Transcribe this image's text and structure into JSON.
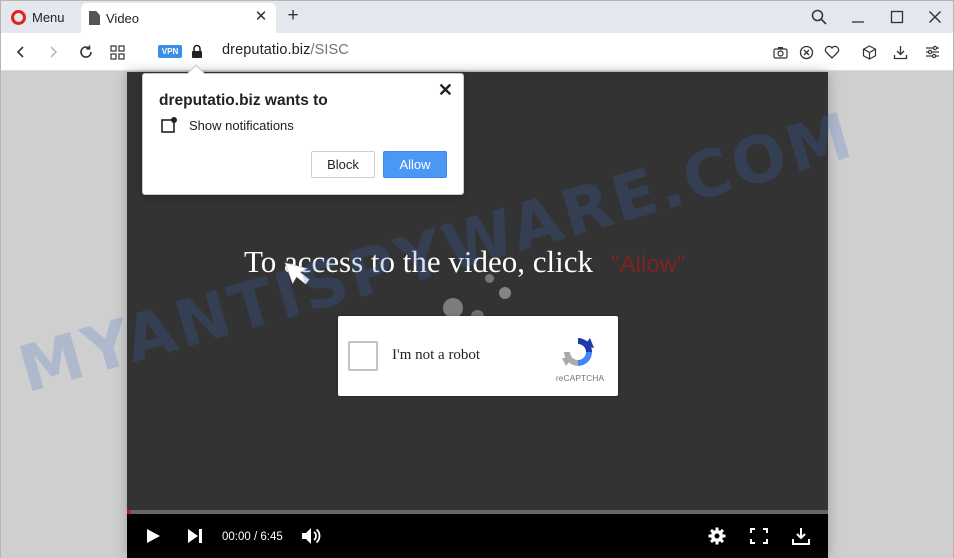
{
  "browser": {
    "menu_label": "Menu",
    "tab_title": "Video",
    "vpn_label": "VPN",
    "url_domain": "dreputatio.biz",
    "url_path": "/SISC"
  },
  "popup": {
    "title": "dreputatio.biz wants to",
    "permission": "Show notifications",
    "block_label": "Block",
    "allow_label": "Allow",
    "close_glyph": "✕"
  },
  "page": {
    "headline": "To access to the video, click",
    "allow_word": "\"Allow\"",
    "captcha_label": "I'm not a robot",
    "captcha_brand": "reCAPTCHA",
    "time": "00:00 / 6:45",
    "played_fraction": 0.004
  },
  "watermark": "MYANTISPYWARE.COM",
  "colors": {
    "allow_button": "#4a97f4",
    "vpn_badge": "#3b8ee8",
    "opera_red": "#e2231a",
    "player_bg": "#333333"
  }
}
